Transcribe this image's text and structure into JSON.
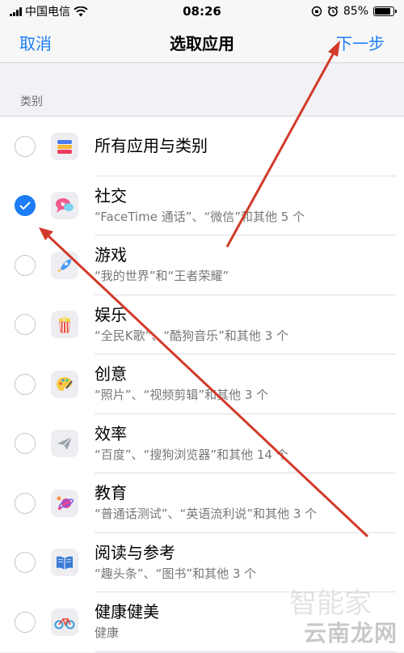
{
  "status_bar": {
    "carrier": "中国电信",
    "time": "08:26",
    "battery": "85%",
    "battery_level": 0.85
  },
  "nav": {
    "cancel": "取消",
    "title": "选取应用",
    "next": "下一步"
  },
  "section": {
    "header": "类别"
  },
  "categories": [
    {
      "title": "所有应用与类别",
      "subtitle": "",
      "checked": false,
      "icon": "stack-icon"
    },
    {
      "title": "社交",
      "subtitle": "“FaceTime 通话”、“微信”和其他 5 个",
      "checked": true,
      "icon": "chat-bubbles-icon"
    },
    {
      "title": "游戏",
      "subtitle": "“我的世界”和“王者荣耀”",
      "checked": false,
      "icon": "rocket-icon"
    },
    {
      "title": "娱乐",
      "subtitle": "“全民K歌”、“酷狗音乐”和其他 3 个",
      "checked": false,
      "icon": "popcorn-icon"
    },
    {
      "title": "创意",
      "subtitle": "“照片”、“视频剪辑”和其他 3 个",
      "checked": false,
      "icon": "palette-icon"
    },
    {
      "title": "效率",
      "subtitle": "“百度”、“搜狗浏览器”和其他 14 个",
      "checked": false,
      "icon": "paper-plane-icon"
    },
    {
      "title": "教育",
      "subtitle": "“普通话测试”、“英语流利说”和其他 3 个",
      "checked": false,
      "icon": "planet-icon"
    },
    {
      "title": "阅读与参考",
      "subtitle": "“趣头条”、“图书”和其他 3 个",
      "checked": false,
      "icon": "book-icon"
    },
    {
      "title": "健康健美",
      "subtitle": "健康",
      "checked": false,
      "icon": "bicycle-icon"
    }
  ],
  "watermark": "云南龙网",
  "watermark_faint": "智能家",
  "colors": {
    "accent": "#1b7cf5",
    "arrow": "#d23a2a"
  }
}
